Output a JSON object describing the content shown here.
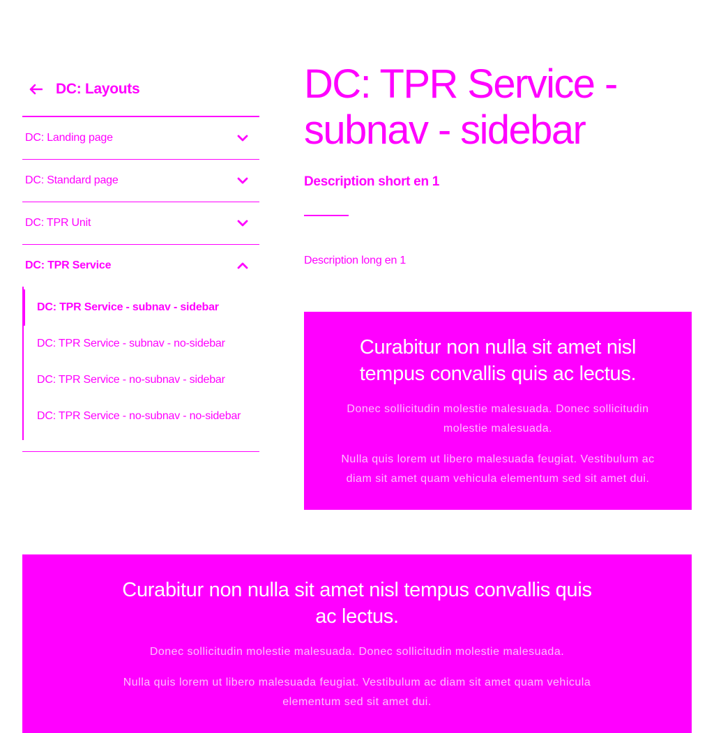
{
  "sidebar": {
    "back_label": "DC: Layouts",
    "items": [
      {
        "label": "DC: Landing page"
      },
      {
        "label": "DC: Standard page"
      },
      {
        "label": "DC: TPR Unit"
      },
      {
        "label": "DC: TPR Service"
      }
    ],
    "subitems": [
      {
        "label": "DC: TPR Service - subnav - sidebar"
      },
      {
        "label": "DC: TPR Service - subnav - no-sidebar"
      },
      {
        "label": "DC: TPR Service - no-subnav - sidebar"
      },
      {
        "label": "DC: TPR Service - no-subnav - no-sidebar"
      }
    ]
  },
  "main": {
    "title": "DC: TPR Service - subnav - sidebar",
    "description_short": "Description short en 1",
    "description_long": "Description long en 1"
  },
  "callout_small": {
    "title": "Curabitur non nulla sit amet nisl tempus convallis quis ac lectus.",
    "para1": "Donec sollicitudin molestie malesuada. Donec sollicitudin molestie malesuada.",
    "para2": "Nulla quis lorem ut libero malesuada feugiat. Vestibulum ac diam sit amet quam vehicula elementum sed sit amet dui."
  },
  "callout_wide": {
    "title": "Curabitur non nulla sit amet nisl tempus convallis quis ac lectus.",
    "para1": "Donec sollicitudin molestie malesuada. Donec sollicitudin molestie malesuada.",
    "para2": "Nulla quis lorem ut libero malesuada feugiat. Vestibulum ac diam sit amet quam vehicula elementum sed sit amet dui."
  },
  "colors": {
    "accent": "#ff00ff",
    "background": "#ffffff"
  },
  "icons": {
    "back": "arrow-left-icon",
    "expand": "chevron-down-icon",
    "collapse": "chevron-up-icon"
  }
}
